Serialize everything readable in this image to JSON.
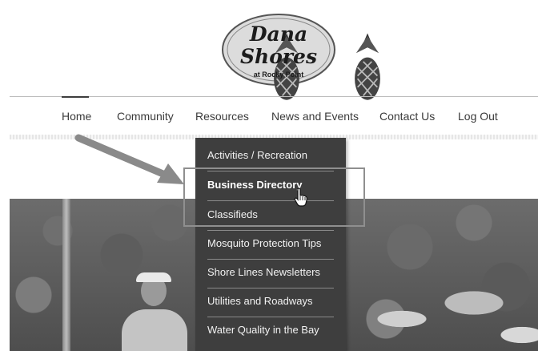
{
  "logo": {
    "line1": "Dana",
    "line2": "Shores",
    "subtitle": "at Rocky Point"
  },
  "nav": {
    "items": [
      "Home",
      "Community",
      "Resources",
      "News and Events",
      "Contact Us",
      "Log Out"
    ],
    "active": "Home"
  },
  "dropdown": {
    "parent": "Resources",
    "items": [
      "Activities / Recreation",
      "Business Directory",
      "Classifieds",
      "Mosquito Protection Tips",
      "Shore Lines Newsletters",
      "Utilities and Roadways",
      "Water Quality in the Bay"
    ],
    "highlighted": "Business Directory"
  },
  "colors": {
    "dropdown_bg": "#3e3e3e",
    "callout": "#8f8f8f",
    "arrow": "#8a8a8a"
  },
  "icons": [
    "pineapple-icon",
    "pointer-hand-icon",
    "arrow-annotation"
  ]
}
